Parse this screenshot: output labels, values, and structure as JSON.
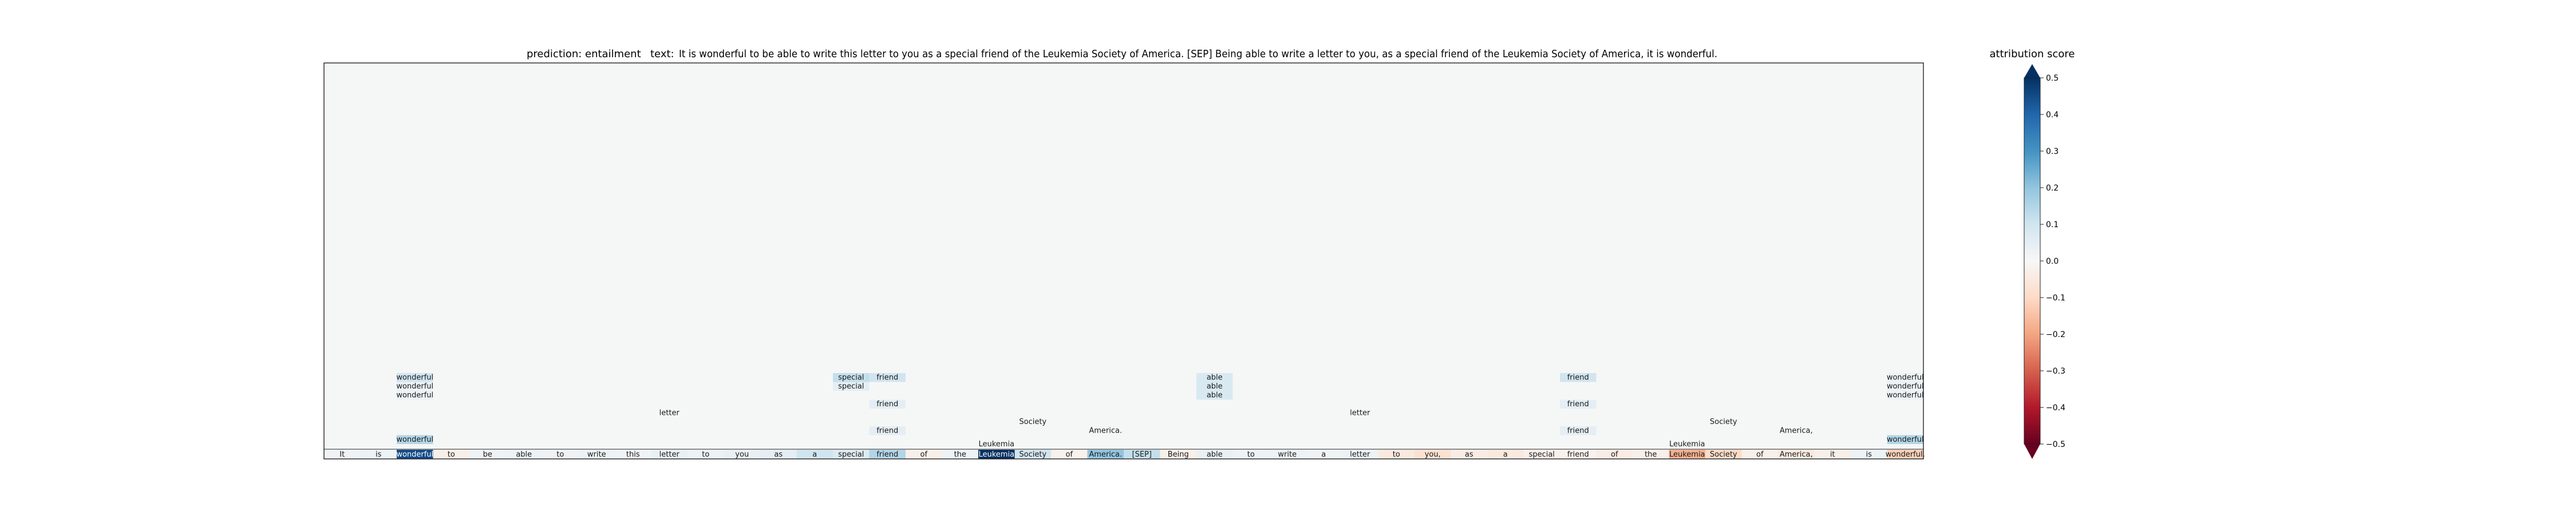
{
  "chart_data": {
    "type": "heatmap",
    "title": {
      "prediction_label": "prediction:",
      "prediction_value": "entailment",
      "text_label": "text:",
      "text_value": "It is wonderful to be able to write this letter to you as a special friend of the Leukemia Society of America. [SEP] Being able to write a letter to you, as a special friend of the Leukemia Society of America, it is wonderful."
    },
    "tokens": [
      "It",
      "is",
      "wonderful",
      "to",
      "be",
      "able",
      "to",
      "write",
      "this",
      "letter",
      "to",
      "you",
      "as",
      "a",
      "special",
      "friend",
      "of",
      "the",
      "Leukemia",
      "Society",
      "of",
      "America.",
      "[SEP]",
      "Being",
      "able",
      "to",
      "write",
      "a",
      "letter",
      "to",
      "you,",
      "as",
      "a",
      "special",
      "friend",
      "of",
      "the",
      "Leukemia",
      "Society",
      "of",
      "America,",
      "it",
      "is",
      "wonderful."
    ],
    "attribution_scores": [
      0.02,
      0.03,
      0.45,
      -0.03,
      0.02,
      0.03,
      0.02,
      0.03,
      0.02,
      0.04,
      0.03,
      0.04,
      0.05,
      0.1,
      0.07,
      0.15,
      -0.03,
      0.03,
      0.55,
      0.1,
      -0.02,
      0.2,
      0.12,
      -0.03,
      0.04,
      0.03,
      0.03,
      0.02,
      0.03,
      -0.05,
      -0.08,
      -0.04,
      -0.05,
      -0.03,
      -0.02,
      -0.04,
      -0.03,
      -0.18,
      -0.1,
      -0.03,
      -0.05,
      -0.03,
      0.03,
      -0.12
    ],
    "upper_panel_labels": [
      {
        "text": "wonderful",
        "token_index": 2,
        "row": 13,
        "score": 0.1
      },
      {
        "text": "wonderful",
        "token_index": 2,
        "row": 14,
        "score": 0.03
      },
      {
        "text": "wonderful",
        "token_index": 2,
        "row": 15,
        "score": 0.03
      },
      {
        "text": "wonderful",
        "token_index": 2,
        "row": 20,
        "score": 0.15
      },
      {
        "text": "letter",
        "token_index": 9,
        "row": 17,
        "score": 0.0
      },
      {
        "text": "special",
        "token_index": 14,
        "row": 13,
        "score": 0.12
      },
      {
        "text": "special",
        "token_index": 14,
        "row": 14,
        "score": 0.05
      },
      {
        "text": "friend",
        "token_index": 15,
        "row": 13,
        "score": 0.1
      },
      {
        "text": "friend",
        "token_index": 15,
        "row": 16,
        "score": 0.05
      },
      {
        "text": "friend",
        "token_index": 15,
        "row": 19,
        "score": 0.05
      },
      {
        "text": "Society",
        "token_index": 19,
        "row": 18,
        "score": 0.0
      },
      {
        "text": "America.",
        "token_index": 21,
        "row": 19,
        "score": 0.0
      },
      {
        "text": "able",
        "token_index": 24,
        "row": 13,
        "score": 0.08
      },
      {
        "text": "able",
        "token_index": 24,
        "row": 14,
        "score": 0.08
      },
      {
        "text": "able",
        "token_index": 24,
        "row": 15,
        "score": 0.08
      },
      {
        "text": "letter",
        "token_index": 28,
        "row": 17,
        "score": 0.0
      },
      {
        "text": "friend",
        "token_index": 34,
        "row": 13,
        "score": 0.1
      },
      {
        "text": "friend",
        "token_index": 34,
        "row": 16,
        "score": 0.05
      },
      {
        "text": "friend",
        "token_index": 34,
        "row": 19,
        "score": 0.05
      },
      {
        "text": "Society",
        "token_index": 38,
        "row": 18,
        "score": 0.0
      },
      {
        "text": "America,",
        "token_index": 40,
        "row": 19,
        "score": 0.0
      },
      {
        "text": "wonderful",
        "token_index": 43,
        "row": 13,
        "score": 0.03
      },
      {
        "text": "wonderful",
        "token_index": 43,
        "row": 14,
        "score": 0.03
      },
      {
        "text": "wonderful",
        "token_index": 43,
        "row": 15,
        "score": 0.03
      },
      {
        "text": "wonderful",
        "token_index": 43,
        "row": 20,
        "score": 0.15
      }
    ],
    "leukemia_labels": [
      {
        "text": "Leukemia",
        "token_index": 18
      },
      {
        "text": "Leukemia",
        "token_index": 37
      }
    ],
    "colorbar": {
      "title": "attribution score",
      "ticks": [
        0.5,
        0.4,
        0.3,
        0.2,
        0.1,
        0.0,
        -0.1,
        -0.2,
        -0.3,
        -0.4,
        -0.5
      ],
      "tick_labels": [
        "0.5",
        "0.4",
        "0.3",
        "0.2",
        "0.1",
        "0.0",
        "−0.1",
        "−0.2",
        "−0.3",
        "−0.4",
        "−0.5"
      ],
      "range": [
        -0.5,
        0.5
      ],
      "extend": "both"
    },
    "colormap": [
      "#67001f",
      "#b2182b",
      "#d6604d",
      "#f4a582",
      "#fddbc7",
      "#f7f7f7",
      "#d1e5f0",
      "#92c5de",
      "#4393c3",
      "#2166ac",
      "#053061"
    ]
  }
}
